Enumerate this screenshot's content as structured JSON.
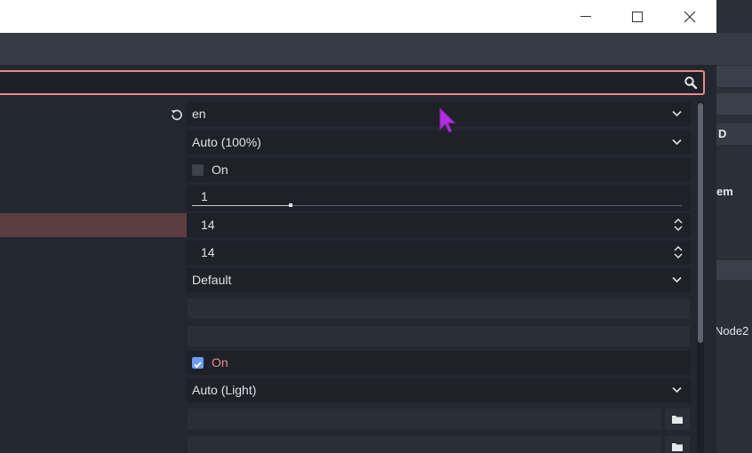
{
  "window": {
    "minimize_icon": "minimize-icon",
    "maximize_icon": "maximize-icon",
    "close_icon": "close-icon"
  },
  "search": {
    "value": "",
    "placeholder": "",
    "icon": "search-icon"
  },
  "properties": {
    "language": {
      "value": "en",
      "revert_icon": "revert-icon"
    },
    "display_scale": {
      "value": "Auto (100%)"
    },
    "toggle_one": {
      "label": "On",
      "checked": false
    },
    "slider": {
      "value": "1",
      "level": 0.2
    },
    "spin_one": {
      "value": "14"
    },
    "spin_two": {
      "value": "14"
    },
    "select_default": {
      "value": "Default"
    },
    "empty_one": {
      "value": ""
    },
    "empty_two": {
      "value": ""
    },
    "toggle_two": {
      "label": "On",
      "checked": true
    },
    "theme_mode": {
      "value": "Auto (Light)"
    },
    "path_one": {
      "value": ""
    },
    "path_two": {
      "value": ""
    }
  },
  "background_editor": {
    "label_d": "D",
    "label_em": "em",
    "label_node": "Node2"
  },
  "colors": {
    "accent": "#e98a8a",
    "selection": "#5c3d42",
    "checkbox_on": "#6b9ef0",
    "active_label": "#e98a8a",
    "cursor": "#b32de0"
  }
}
